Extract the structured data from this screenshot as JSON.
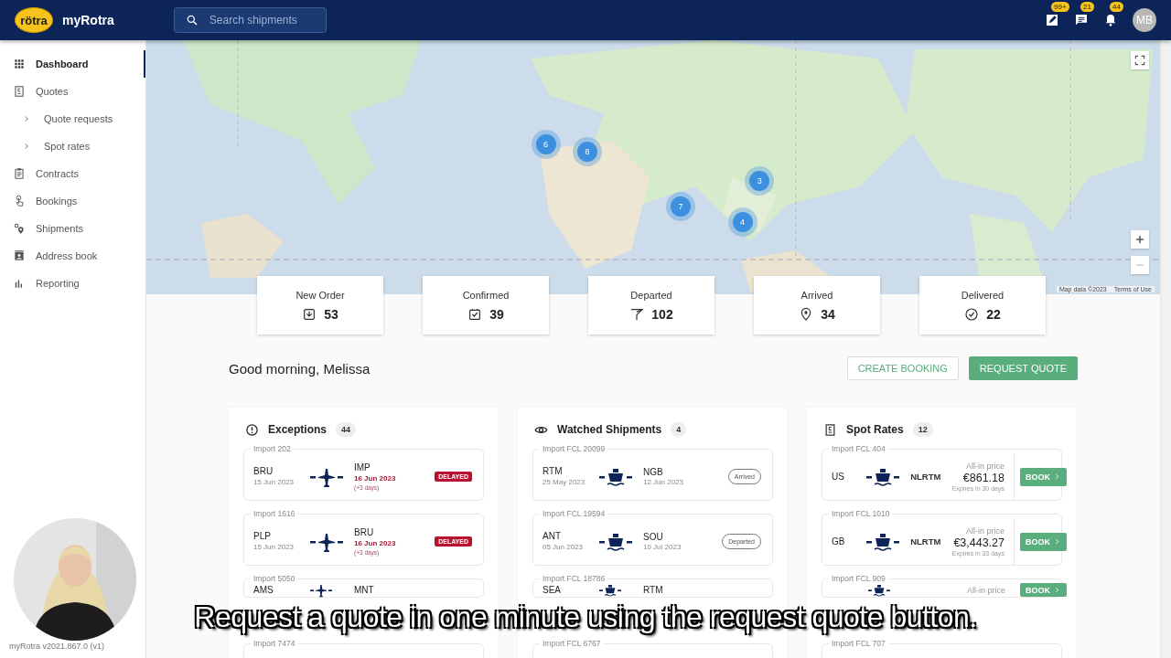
{
  "header": {
    "logo_text": "rötra",
    "app_name": "myRotra",
    "search": {
      "placeholder": "Search shipments"
    },
    "actions": [
      {
        "kind": "edit",
        "badge": "99+"
      },
      {
        "kind": "chat",
        "badge": "21"
      },
      {
        "kind": "bell",
        "badge": "44"
      }
    ],
    "avatar": "MB"
  },
  "sidebar": {
    "items": [
      {
        "kind": "grid",
        "label": "Dashboard",
        "selected": true
      },
      {
        "kind": "quote",
        "label": "Quotes",
        "selected": false
      },
      {
        "kind": "sub",
        "label": "Quote requests",
        "selected": false
      },
      {
        "kind": "sub",
        "label": "Spot rates",
        "selected": false
      },
      {
        "kind": "clipboard",
        "label": "Contracts",
        "selected": false
      },
      {
        "kind": "hand",
        "label": "Bookings",
        "selected": false
      },
      {
        "kind": "pins",
        "label": "Shipments",
        "selected": false
      },
      {
        "kind": "contact",
        "label": "Address book",
        "selected": false
      },
      {
        "kind": "chart",
        "label": "Reporting",
        "selected": false
      }
    ],
    "version": "myRotra v2021.867.0 (v1)"
  },
  "map": {
    "kind": "picture",
    "clusters": [
      {
        "count": "6"
      },
      {
        "count": "8"
      },
      {
        "count": "3"
      },
      {
        "count": "7"
      },
      {
        "count": "4"
      }
    ],
    "attribution": [
      "Map data ©2023",
      "Terms of Use"
    ]
  },
  "stats": [
    {
      "kind": "order",
      "label": "New Order",
      "value": "53"
    },
    {
      "kind": "confirmed",
      "label": "Confirmed",
      "value": "39"
    },
    {
      "kind": "departed",
      "label": "Departed",
      "value": "102"
    },
    {
      "kind": "arrived",
      "label": "Arrived",
      "value": "34"
    },
    {
      "kind": "delivered",
      "label": "Delivered",
      "value": "22"
    }
  ],
  "greeting": "Good morning, Melissa",
  "buttons": [
    {
      "kind": "outline",
      "label": "CREATE BOOKING"
    },
    {
      "kind": "filled",
      "label": "REQUEST QUOTE"
    }
  ],
  "panels": [
    {
      "kind": "exceptions",
      "title": "Exceptions",
      "count": "44",
      "rows": [
        {
          "ref": "Import 202",
          "kind": "air",
          "origin": "BRU",
          "origin_date": "15 Jun 2023",
          "dest": "IMP",
          "dest_date": "16 Jun 2023",
          "note": "(+3 days)",
          "status": "DELAYED"
        },
        {
          "ref": "Import 1616",
          "kind": "air",
          "origin": "PLP",
          "origin_date": "15 Jun 2023",
          "dest": "BRU",
          "dest_date": "16 Jun 2023",
          "note": "(+3 days)",
          "status": "DELAYED"
        },
        {
          "ref": "Import 5050",
          "kind": "air",
          "origin": "AMS",
          "dest": "MNT"
        },
        {
          "ref": "Import 7474"
        }
      ]
    },
    {
      "kind": "watched",
      "title": "Watched Shipments",
      "count": "4",
      "rows": [
        {
          "ref": "Import FCL 20099",
          "kind": "sea",
          "origin": "RTM",
          "origin_date": "25 May 2023",
          "dest": "NGB",
          "dest_date": "12 Jun 2023",
          "status": "Arrived"
        },
        {
          "ref": "Import FCL 19594",
          "kind": "sea",
          "origin": "ANT",
          "origin_date": "05 Jun 2023",
          "dest": "SOU",
          "dest_date": "10 Jul 2023",
          "status": "Departed"
        },
        {
          "ref": "Import FCL 18786",
          "kind": "sea",
          "origin": "SEA",
          "dest": "RTM"
        },
        {
          "ref": "Import FCL 6767"
        }
      ]
    },
    {
      "kind": "spot_rates",
      "title": "Spot Rates",
      "count": "12",
      "rows": [
        {
          "ref": "Import FCL 404",
          "kind": "sea",
          "origin": "US",
          "dest": "NLRTM",
          "price_label": "All-in price",
          "price": "€861.18",
          "expiry": "Expires in 30 days",
          "action": "BOOK"
        },
        {
          "ref": "Import FCL 1010",
          "kind": "sea",
          "origin": "GB",
          "dest": "NLRTM",
          "price_label": "All-in price",
          "price": "€3,443.27",
          "expiry": "Expires in 33 days",
          "action": "BOOK"
        },
        {
          "ref": "Import FCL 909",
          "kind": "sea",
          "price_label": "All-in price",
          "action": "BOOK"
        },
        {
          "ref": "Import FCL 707"
        }
      ]
    }
  ],
  "caption": "Request a quote in one minute using the request quote button."
}
